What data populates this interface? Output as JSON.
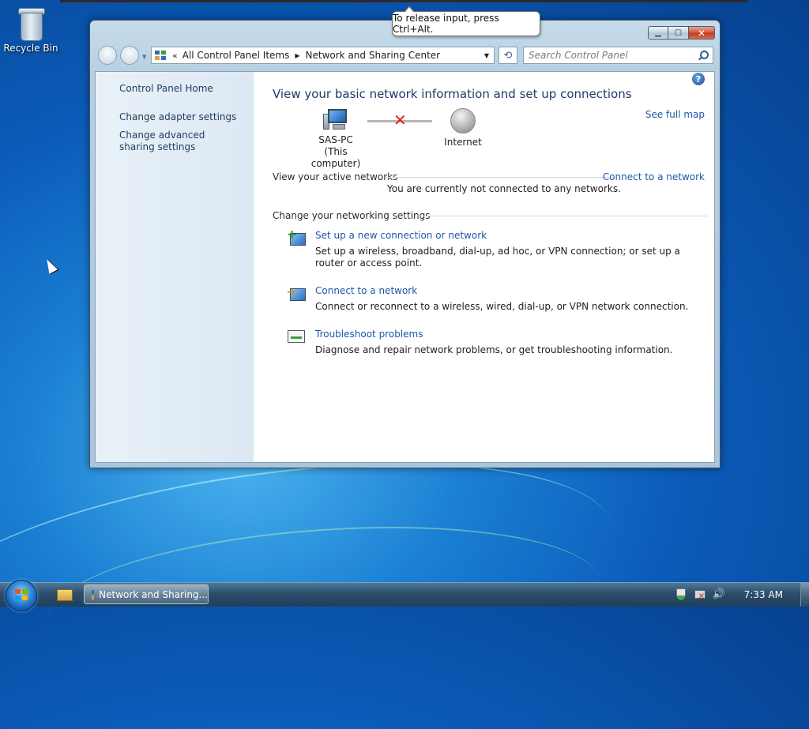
{
  "desktop": {
    "recycle_bin_label": "Recycle Bin"
  },
  "vm_tooltip": {
    "text": "To release input, press Ctrl+Alt."
  },
  "window": {
    "address": {
      "overflow": "«",
      "crumbs": [
        "All Control Panel Items",
        "Network and Sharing Center"
      ]
    },
    "search": {
      "placeholder": "Search Control Panel"
    },
    "left_pane": {
      "home": "Control Panel Home",
      "links": [
        "Change adapter settings",
        "Change advanced sharing settings"
      ]
    },
    "main": {
      "heading": "View your basic network information and set up connections",
      "see_full_map": "See full map",
      "map": {
        "computer_name": "SAS-PC",
        "computer_sub": "(This computer)",
        "internet": "Internet"
      },
      "active_networks": {
        "label": "View your active networks",
        "connect_link": "Connect to a network",
        "status": "You are currently not connected to any networks."
      },
      "settings": {
        "label": "Change your networking settings",
        "tasks": [
          {
            "title": "Set up a new connection or network",
            "desc": "Set up a wireless, broadband, dial-up, ad hoc, or VPN connection; or set up a router or access point.",
            "icon": "new-connection-icon"
          },
          {
            "title": "Connect to a network",
            "desc": "Connect or reconnect to a wireless, wired, dial-up, or VPN network connection.",
            "icon": "connect-network-icon"
          },
          {
            "title": "Troubleshoot problems",
            "desc": "Diagnose and repair network problems, or get troubleshooting information.",
            "icon": "troubleshoot-icon"
          }
        ]
      }
    }
  },
  "taskbar": {
    "task_label": "Network and Sharing...",
    "clock": "7:33 AM"
  }
}
